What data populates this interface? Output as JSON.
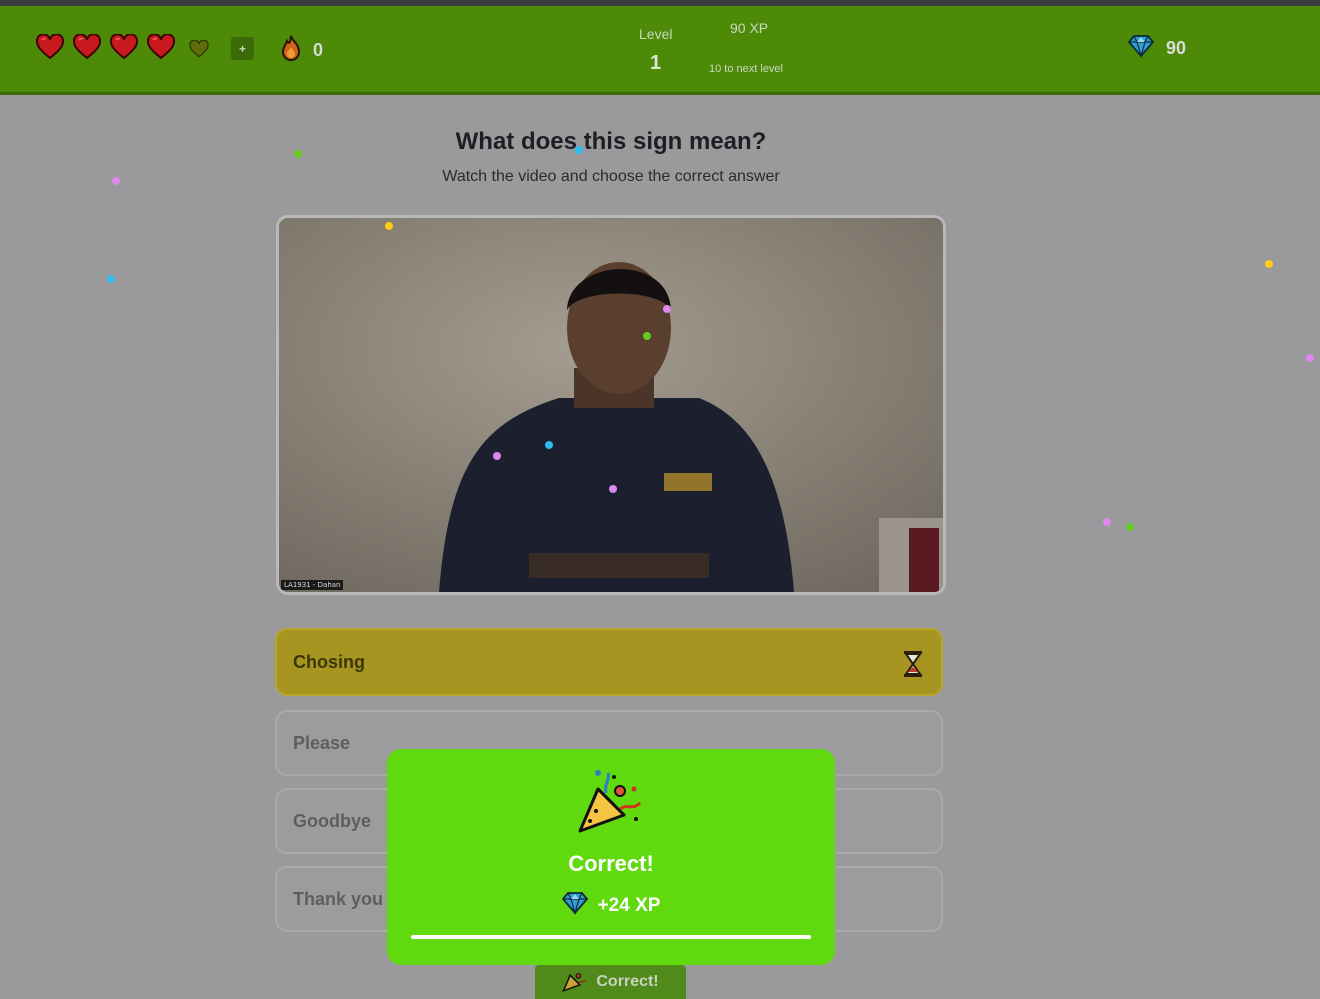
{
  "header": {
    "hearts": {
      "filled": 4,
      "total": 5
    },
    "add_hearts_label": "+",
    "streak": "0",
    "level_label": "Level",
    "level_value": "1",
    "xp_total": "90 XP",
    "xp_to_next": "10 to next level",
    "gems": "90",
    "colors": {
      "bar": "#4d8a08",
      "heart": "#c8191f"
    }
  },
  "question": {
    "title": "What does this sign mean?",
    "subtitle": "Watch the video and choose the correct answer"
  },
  "video": {
    "caption": "LA1931 - Dahan"
  },
  "answers": [
    {
      "label": "Chosing",
      "state": "selected"
    },
    {
      "label": "Please",
      "state": "default"
    },
    {
      "label": "Goodbye",
      "state": "default"
    },
    {
      "label": "Thank you",
      "state": "default"
    }
  ],
  "feedback": {
    "icon": "party-popper-icon",
    "title": "Correct!",
    "xp_gain": "+24 XP",
    "color": "#60d90e"
  },
  "continue_button": {
    "label": "Correct!",
    "icon": "party-popper-icon"
  }
}
